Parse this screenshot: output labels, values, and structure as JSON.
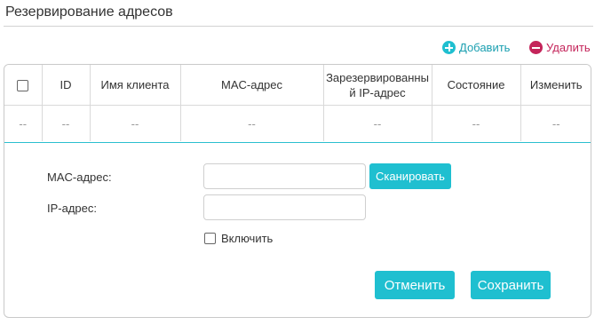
{
  "section": {
    "title": "Резервирование адресов"
  },
  "toolbar": {
    "add_label": "Добавить",
    "delete_label": "Удалить"
  },
  "table": {
    "columns": [
      "ID",
      "Имя клиента",
      "MAC-адрес",
      "Зарезервированный IP-адрес",
      "Состояние",
      "Изменить"
    ],
    "column_lines": {
      "reserved_ip": [
        "Зарезервированны",
        "й IP-адрес"
      ]
    },
    "row": [
      "--",
      "--",
      "--",
      "--",
      "--",
      "--",
      "--"
    ]
  },
  "form": {
    "mac_label": "MAC-адрес:",
    "mac_value": "",
    "ip_label": "IP-адрес:",
    "ip_value": "",
    "scan_label": "Сканировать",
    "enable_label": "Включить",
    "enable_checked": false,
    "cancel_label": "Отменить",
    "save_label": "Сохранить"
  },
  "colors": {
    "accent": "#1fbfd0",
    "danger": "#c4245a",
    "border": "#d9d9d9"
  }
}
